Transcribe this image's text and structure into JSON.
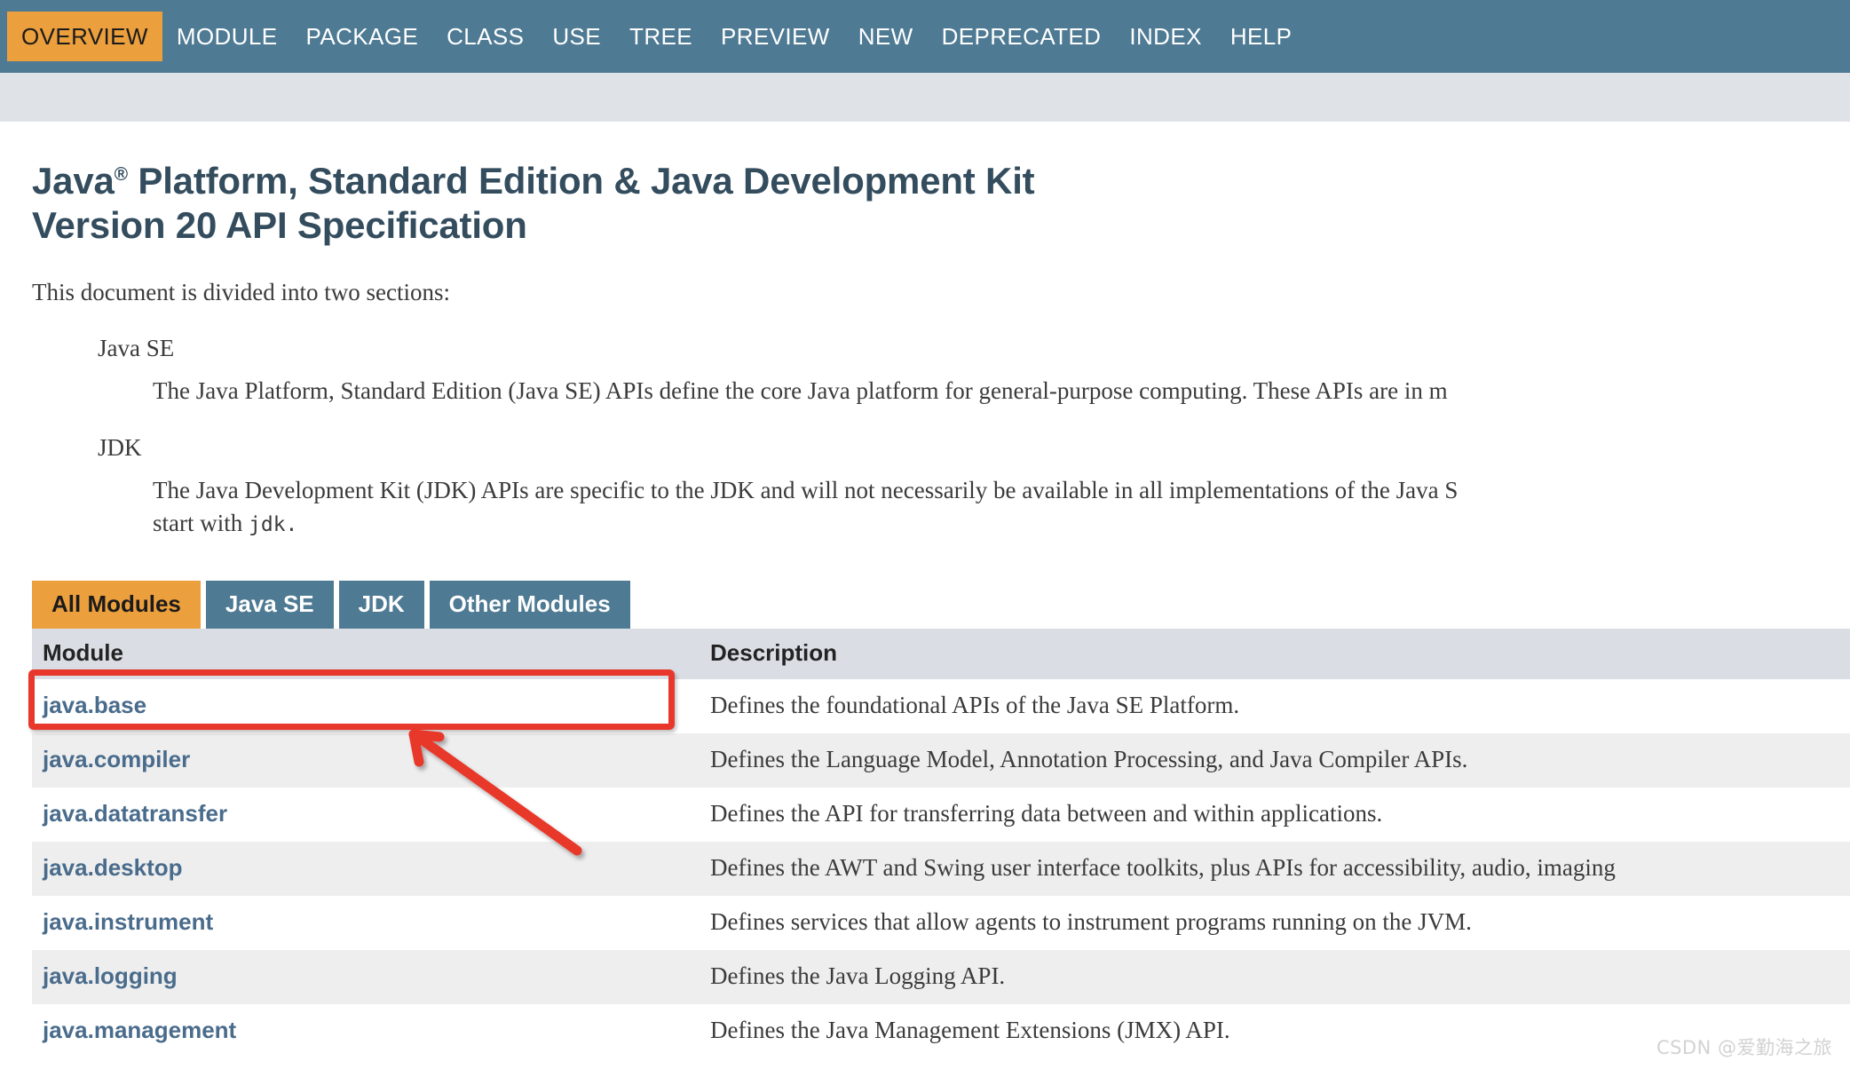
{
  "topnav": {
    "items": [
      {
        "label": "OVERVIEW",
        "active": true
      },
      {
        "label": "MODULE",
        "active": false
      },
      {
        "label": "PACKAGE",
        "active": false
      },
      {
        "label": "CLASS",
        "active": false
      },
      {
        "label": "USE",
        "active": false
      },
      {
        "label": "TREE",
        "active": false
      },
      {
        "label": "PREVIEW",
        "active": false
      },
      {
        "label": "NEW",
        "active": false
      },
      {
        "label": "DEPRECATED",
        "active": false
      },
      {
        "label": "INDEX",
        "active": false
      },
      {
        "label": "HELP",
        "active": false
      }
    ]
  },
  "header": {
    "title_line1_pre": "Java",
    "title_line1_sup": "®",
    "title_line1_post": " Platform, Standard Edition & Java Development Kit",
    "title_line2": "Version 20 API Specification"
  },
  "intro": {
    "text": "This document is divided into two sections:"
  },
  "sections": [
    {
      "term": "Java SE",
      "desc": "The Java Platform, Standard Edition (Java SE) APIs define the core Java platform for general-purpose computing. These APIs are in m"
    },
    {
      "term": "JDK",
      "desc_part1": "The Java Development Kit (JDK) APIs are specific to the JDK and will not necessarily be available in all implementations of the Java S",
      "desc_part2": "start with ",
      "desc_code": "jdk."
    }
  ],
  "tabs": [
    {
      "label": "All Modules",
      "active": true
    },
    {
      "label": "Java SE",
      "active": false
    },
    {
      "label": "JDK",
      "active": false
    },
    {
      "label": "Other Modules",
      "active": false
    }
  ],
  "table": {
    "headers": [
      "Module",
      "Description"
    ],
    "rows": [
      {
        "module": "java.base",
        "description": "Defines the foundational APIs of the Java SE Platform."
      },
      {
        "module": "java.compiler",
        "description": "Defines the Language Model, Annotation Processing, and Java Compiler APIs."
      },
      {
        "module": "java.datatransfer",
        "description": "Defines the API for transferring data between and within applications."
      },
      {
        "module": "java.desktop",
        "description": "Defines the AWT and Swing user interface toolkits, plus APIs for accessibility, audio, imaging"
      },
      {
        "module": "java.instrument",
        "description": "Defines services that allow agents to instrument programs running on the JVM."
      },
      {
        "module": "java.logging",
        "description": "Defines the Java Logging API."
      },
      {
        "module": "java.management",
        "description": "Defines the Java Management Extensions (JMX) API."
      }
    ]
  },
  "annotation": {
    "highlight_target": "java.base",
    "color": "#E8372B"
  },
  "watermark": {
    "text": "CSDN @爱勤海之旅"
  },
  "colors": {
    "navbar": "#4E7A94",
    "accent_orange": "#EC9F3D",
    "subnav": "#DFE2E7",
    "table_header": "#DADEE4",
    "row_alt": "#EEEEEE",
    "link": "#4A6C8C",
    "heading": "#344D5E",
    "annotation_red": "#E8372B"
  }
}
